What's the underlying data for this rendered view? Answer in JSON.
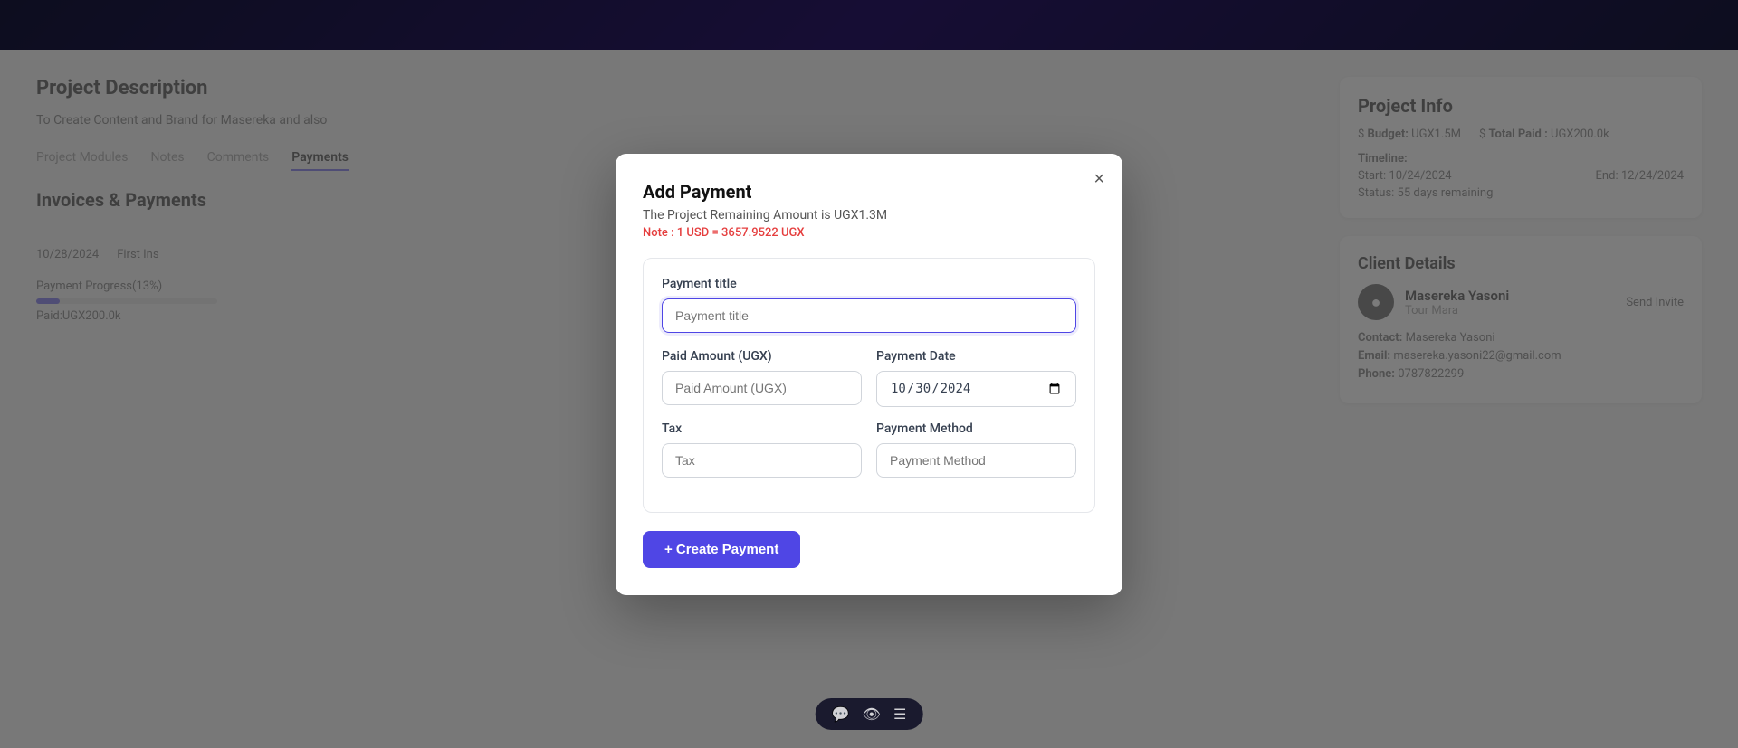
{
  "topBar": {
    "background": "gradient dark purple"
  },
  "background": {
    "leftPanel": {
      "sectionTitle": "Project Description",
      "descriptionText": "To Create Content and Brand for Masereka and also",
      "tabs": [
        {
          "label": "Project Modules",
          "active": false
        },
        {
          "label": "Notes",
          "active": false
        },
        {
          "label": "Comments",
          "active": false
        },
        {
          "label": "Payments",
          "active": true
        }
      ],
      "invoicesTitle": "Invoices & Payments",
      "paymentsColumn": "Payments",
      "paymentDate": "10/28/2024",
      "paymentName": "First Ins",
      "progressLabel": "Payment Progress(13%)",
      "progressPercent": 13,
      "paidLabel": "Paid:UGX200.0k"
    },
    "rightPanel": {
      "projectInfoTitle": "Project Info",
      "budgetLabel": "Budget:",
      "budgetValue": "UGX1.5M",
      "totalPaidLabel": "Total Paid :",
      "totalPaidValue": "UGX200.0k",
      "timelineLabel": "Timeline:",
      "startLabel": "Start: 10/24/2024",
      "endLabel": "End: 12/24/2024",
      "statusLabel": "Status: 55 days remaining",
      "clientDetailsTitle": "Client Details",
      "clientName": "Masereka Yasoni",
      "clientCompany": "Tour Mara",
      "sendInviteLabel": "Send Invite",
      "contactLabel": "Contact:",
      "contactValue": "Masereka Yasoni",
      "emailLabel": "Email:",
      "emailValue": "masereka.yasoni22@gmail.com",
      "phoneLabel": "Phone:",
      "phoneValue": "0787822299"
    }
  },
  "modal": {
    "title": "Add Payment",
    "subtitle": "The Project Remaining Amount is UGX1.3M",
    "note": "Note : 1 USD = 3657.9522 UGX",
    "closeLabel": "×",
    "form": {
      "paymentTitleLabel": "Payment title",
      "paymentTitlePlaceholder": "Payment title",
      "paidAmountLabel": "Paid Amount (UGX)",
      "paidAmountPlaceholder": "Paid Amount (UGX)",
      "paymentDateLabel": "Payment Date",
      "paymentDateValue": "30/10/2024",
      "taxLabel": "Tax",
      "taxPlaceholder": "Tax",
      "paymentMethodLabel": "Payment Method",
      "paymentMethodPlaceholder": "Payment Method"
    },
    "createButtonLabel": "+ Create Payment"
  },
  "bottomToolbar": {
    "icons": [
      "chat-icon",
      "eye-icon",
      "list-icon"
    ]
  }
}
